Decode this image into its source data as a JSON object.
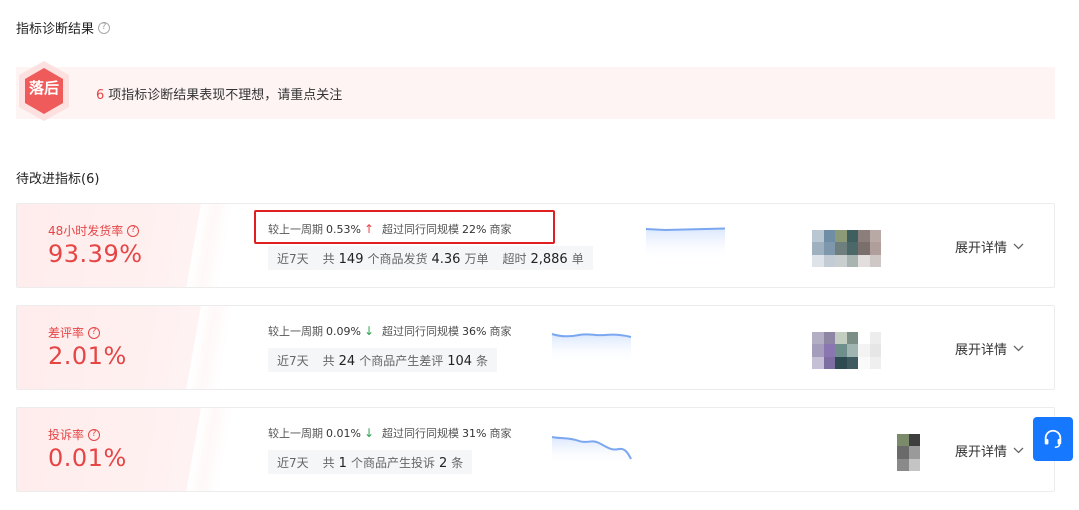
{
  "header": {
    "title": "指标诊断结果",
    "help_icon": "question-circle-icon"
  },
  "alert": {
    "badge_label": "落后",
    "badge_color": "#ef5a5a",
    "count": "6",
    "message": "项指标诊断结果表现不理想，请重点关注"
  },
  "section": {
    "title": "待改进指标(6)"
  },
  "metrics": [
    {
      "name": "48小时发货率",
      "value": "93.39%",
      "compare_label": "较上一周期",
      "compare_value": "0.53%",
      "compare_direction": "up",
      "compare_arrow": "↑",
      "peer_label": "超过同行同规模",
      "peer_value": "22%",
      "peer_unit": "商家",
      "period": "近7天",
      "stat1_prefix": "共",
      "stat1_value": "149",
      "stat1_suffix": "个商品发货",
      "stat2_value": "4.36",
      "stat2_suffix": "万单",
      "stat3_prefix": "超时",
      "stat3_value": "2,886",
      "stat3_suffix": "单",
      "expand_label": "展开详情"
    },
    {
      "name": "差评率",
      "value": "2.01%",
      "compare_label": "较上一周期",
      "compare_value": "0.09%",
      "compare_direction": "down",
      "compare_arrow": "↓",
      "peer_label": "超过同行同规模",
      "peer_value": "36%",
      "peer_unit": "商家",
      "period": "近7天",
      "stat1_prefix": "共",
      "stat1_value": "24",
      "stat1_suffix": "个商品产生差评",
      "stat2_value": "104",
      "stat2_suffix": "条",
      "expand_label": "展开详情"
    },
    {
      "name": "投诉率",
      "value": "0.01%",
      "compare_label": "较上一周期",
      "compare_value": "0.01%",
      "compare_direction": "down",
      "compare_arrow": "↓",
      "peer_label": "超过同行同规模",
      "peer_value": "31%",
      "peer_unit": "商家",
      "period": "近7天",
      "stat1_prefix": "共",
      "stat1_value": "1",
      "stat1_suffix": "个商品产生投诉",
      "stat2_value": "2",
      "stat2_suffix": "条",
      "expand_label": "展开详情"
    }
  ],
  "colors": {
    "accent_red": "#e64545",
    "up_red": "#e64545",
    "down_green": "#2ea44f",
    "spark_blue": "#7aa7f0",
    "cs_blue": "#1677ff"
  },
  "icons": {
    "expand": "chevron-down-icon",
    "customer_service": "headset-icon"
  }
}
